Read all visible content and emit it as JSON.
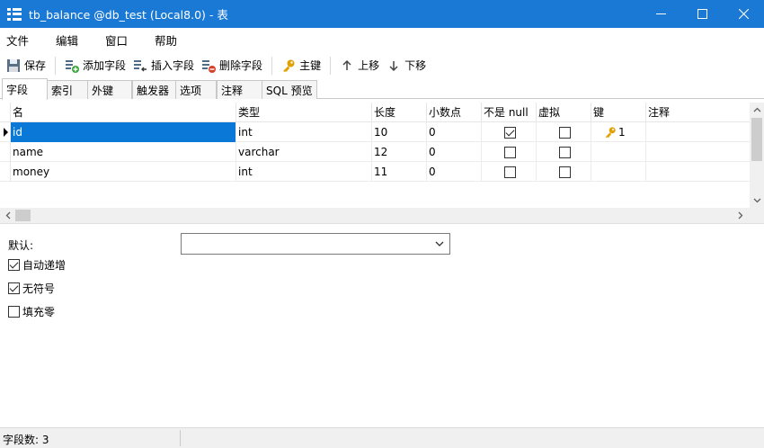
{
  "window": {
    "title": "tb_balance @db_test (Local8.0) - 表"
  },
  "menu": [
    "文件",
    "编辑",
    "窗口",
    "帮助"
  ],
  "toolbar": {
    "save": "保存",
    "add_field": "添加字段",
    "insert_field": "插入字段",
    "delete_field": "删除字段",
    "primary_key": "主键",
    "move_up": "上移",
    "move_down": "下移"
  },
  "tabs": [
    "字段",
    "索引",
    "外键",
    "触发器",
    "选项",
    "注释",
    "SQL 预览"
  ],
  "columns": [
    "名",
    "类型",
    "长度",
    "小数点",
    "不是 null",
    "虚拟",
    "键",
    "注释"
  ],
  "rows": [
    {
      "name": "id",
      "type": "int",
      "length": "10",
      "decimals": "0",
      "not_null": true,
      "virtual": false,
      "key": "1",
      "comment": ""
    },
    {
      "name": "name",
      "type": "varchar",
      "length": "12",
      "decimals": "0",
      "not_null": false,
      "virtual": false,
      "key": "",
      "comment": ""
    },
    {
      "name": "money",
      "type": "int",
      "length": "11",
      "decimals": "0",
      "not_null": false,
      "virtual": false,
      "key": "",
      "comment": ""
    }
  ],
  "props": {
    "default_label": "默认:",
    "default_value": "",
    "auto_increment": {
      "label": "自动递增",
      "checked": true
    },
    "unsigned": {
      "label": "无符号",
      "checked": true
    },
    "zerofill": {
      "label": "填充零",
      "checked": false
    }
  },
  "status": {
    "field_count": "字段数: 3"
  },
  "colors": {
    "titlebar": "#1a79d4",
    "selection": "#0a78d7",
    "key_gold": "#e0a000"
  }
}
